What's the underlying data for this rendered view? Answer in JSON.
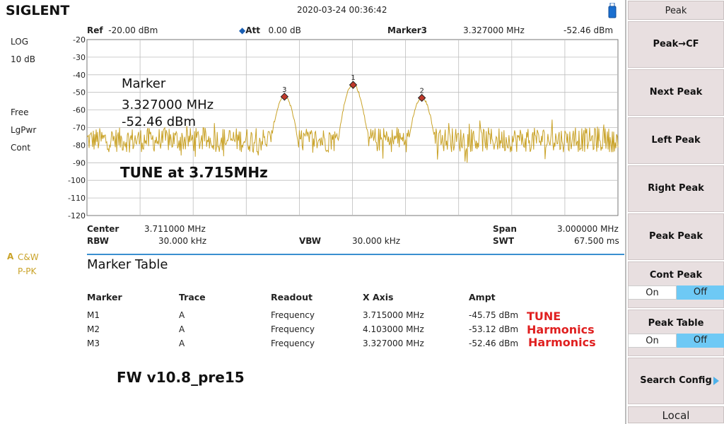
{
  "header": {
    "brand": "SIGLENT",
    "datetime": "2020-03-24   00:36:42"
  },
  "left_info": {
    "scale_type": "LOG",
    "scale_div": "10 dB",
    "sweep_mode": "Free",
    "avg_type": "LgPwr",
    "trigger": "Cont",
    "trace_label": "A",
    "trace_mode": "C&W",
    "detector": "P-PK"
  },
  "status": {
    "ref_label": "Ref",
    "ref_value": "-20.00 dBm",
    "att_label": "Att",
    "att_value": "0.00 dB",
    "marker_label": "Marker3",
    "marker_freq": "3.327000 MHz",
    "marker_ampl": "-52.46 dBm"
  },
  "chart_data": {
    "type": "line",
    "y_tick_labels": [
      "-20",
      "-30",
      "-40",
      "-50",
      "-60",
      "-70",
      "-80",
      "-90",
      "-100",
      "-110",
      "-120"
    ],
    "ylim": [
      -120,
      -20
    ],
    "xlim_mhz": [
      2.211,
      5.211
    ],
    "grid": true,
    "trace_color": "#c9a227",
    "noise_floor_dbm": -77,
    "markers": [
      {
        "label": "1",
        "x_mhz": 3.715,
        "y_dbm": -45.75
      },
      {
        "label": "2",
        "x_mhz": 4.103,
        "y_dbm": -53.12
      },
      {
        "label": "3",
        "x_mhz": 3.327,
        "y_dbm": -52.46
      }
    ],
    "overlay_marker": {
      "title": "Marker",
      "freq": "3.327000 MHz",
      "ampl": "-52.46 dBm"
    },
    "overlay_note": "TUNE at 3.715MHz"
  },
  "bottom": {
    "center_label": "Center",
    "center_value": "3.711000 MHz",
    "span_label": "Span",
    "span_value": "3.000000 MHz",
    "rbw_label": "RBW",
    "rbw_value": "30.000 kHz",
    "vbw_label": "VBW",
    "vbw_value": "30.000 kHz",
    "swt_label": "SWT",
    "swt_value": "67.500 ms"
  },
  "marker_table": {
    "title": "Marker Table",
    "columns": [
      "Marker",
      "Trace",
      "Readout",
      "X Axis",
      "Ampt"
    ],
    "rows": [
      {
        "marker": "M1",
        "trace": "A",
        "readout": "Frequency",
        "x": "3.715000 MHz",
        "ampt": "-45.75 dBm",
        "note": "TUNE"
      },
      {
        "marker": "M2",
        "trace": "A",
        "readout": "Frequency",
        "x": "4.103000 MHz",
        "ampt": "-53.12 dBm",
        "note": "Harmonics"
      },
      {
        "marker": "M3",
        "trace": "A",
        "readout": "Frequency",
        "x": "3.327000 MHz",
        "ampt": "-52.46 dBm",
        "note": "Harmonics"
      }
    ]
  },
  "footer_note": "FW v10.8_pre15",
  "softkeys": {
    "title": "Peak",
    "peak_cf": "Peak→CF",
    "next_peak": "Next Peak",
    "left_peak": "Left Peak",
    "right_peak": "Right Peak",
    "peak_peak": "Peak Peak",
    "cont_peak": "Cont Peak",
    "peak_table": "Peak Table",
    "on": "On",
    "off": "Off",
    "search_config": "Search Config",
    "local": "Local"
  }
}
